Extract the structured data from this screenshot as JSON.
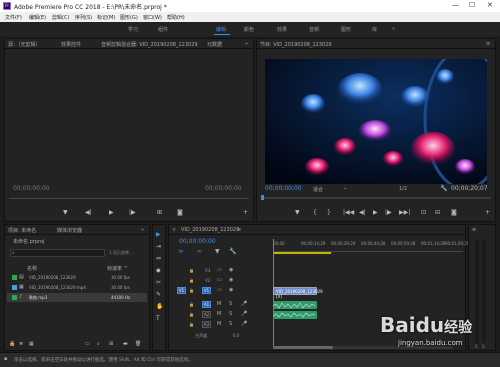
{
  "window": {
    "title": "Adobe Premiere Pro CC 2018 - E:\\PR\\未命名.prproj *",
    "logo": "Pr",
    "min": "—",
    "max": "☐",
    "close": "✕"
  },
  "menu": [
    "文件(F)",
    "编辑(E)",
    "剪辑(C)",
    "序列(S)",
    "标记(M)",
    "图形(G)",
    "窗口(W)",
    "帮助(H)"
  ],
  "workspaces": {
    "items": [
      "学习",
      "组件",
      "编辑",
      "颜色",
      "效果",
      "音频",
      "图形",
      "库"
    ],
    "active_index": 2,
    "more": "»"
  },
  "source_panel": {
    "tabs": [
      "源：（无剪辑）",
      "效果控件",
      "音频剪辑混合器: VID_20190208_123029",
      "元数据"
    ],
    "more": "»",
    "timecode_left": "00;00;00;00",
    "timecode_right": "00;00;00;00"
  },
  "program_panel": {
    "title": "节目: VID_20190208_123029",
    "menu": "≡",
    "timecode": "00;00;00;00",
    "fit": "适合",
    "ratio": "1/2",
    "duration": "00;00;20;07"
  },
  "project_panel": {
    "tabs": [
      "项目: 未命名",
      "媒体浏览器"
    ],
    "more": "»",
    "project_file": "未命名.prproj",
    "search_placeholder": "",
    "selection_count": "1 项已选择…",
    "col_name": "名称",
    "col_rate": "帧速率 ^",
    "items": [
      {
        "color": "#2fa84f",
        "name": "VID_20190208_123029",
        "rate": "30.00 fps"
      },
      {
        "color": "#4aa0d8",
        "name": "VID_20190208_123029.mp4",
        "rate": "30.00 fps"
      },
      {
        "color": "#2fa84f",
        "name": "歌曲.mp3",
        "rate": "44100 Hz"
      }
    ]
  },
  "tools": [
    "▶",
    "⇥",
    "⇔",
    "◆",
    "✂",
    "✎",
    "✋",
    "T"
  ],
  "timeline": {
    "title": "VID_20190208_123029",
    "menu": "≡",
    "timecode": "00;00;00;00",
    "ruler": [
      "00;00",
      "00;00;14;29",
      "00;00;29;29",
      "00;00;44;28",
      "00;00;59;28",
      "00;01;14;29",
      "00;01;29;29"
    ],
    "tracks_video": [
      "V3",
      "V2",
      "V1"
    ],
    "tracks_audio": [
      "A1",
      "A2",
      "A3"
    ],
    "master_label": "主声道",
    "master_value": "0.0",
    "clip_video": "VID_20190208_123029 [V]",
    "clip_audio": ""
  },
  "status": {
    "hint": "单击以选择，或单击空白处并拖动以进行框选。使用 Shift、Alt 和 Ctrl 可获得其他选项。"
  },
  "watermark": {
    "brand": "Baidu",
    "cn": "经验",
    "url": "jingyan.baidu.com"
  },
  "chart_colors": {
    "accent": "#3d8ee8",
    "video_clip": "#6e88c8",
    "audio_clip": "#2f9a6a"
  }
}
